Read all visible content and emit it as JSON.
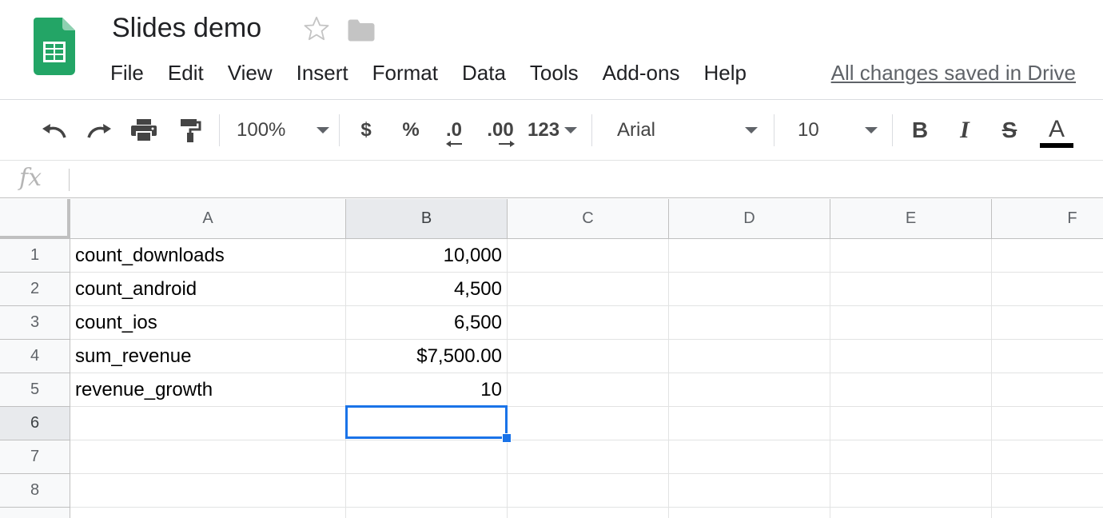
{
  "header": {
    "title": "Slides demo",
    "save_status": "All changes saved in Drive",
    "menu": [
      "File",
      "Edit",
      "View",
      "Insert",
      "Format",
      "Data",
      "Tools",
      "Add-ons",
      "Help"
    ]
  },
  "toolbar": {
    "zoom": "100%",
    "currency": "$",
    "percent": "%",
    "decrease_decimal": ".0",
    "increase_decimal": ".00",
    "more_formats": "123",
    "font": "Arial",
    "font_size": "10",
    "bold": "B",
    "italic": "I",
    "strikethrough": "S",
    "text_color": "A"
  },
  "formula_bar": {
    "icon": "fx",
    "value": ""
  },
  "sheet": {
    "columns": [
      "A",
      "B",
      "C",
      "D",
      "E",
      "F"
    ],
    "rows": [
      "1",
      "2",
      "3",
      "4",
      "5",
      "6",
      "7",
      "8"
    ],
    "cells": [
      [
        "count_downloads",
        "10,000"
      ],
      [
        "count_android",
        "4,500"
      ],
      [
        "count_ios",
        "6,500"
      ],
      [
        "sum_revenue",
        "$7,500.00"
      ],
      [
        "revenue_growth",
        "10"
      ],
      [
        "",
        ""
      ],
      [
        "",
        ""
      ],
      [
        "",
        ""
      ]
    ],
    "selected_cell": "B6"
  },
  "colors": {
    "accent": "#1a73e8",
    "sheets_green": "#0f9d58"
  }
}
